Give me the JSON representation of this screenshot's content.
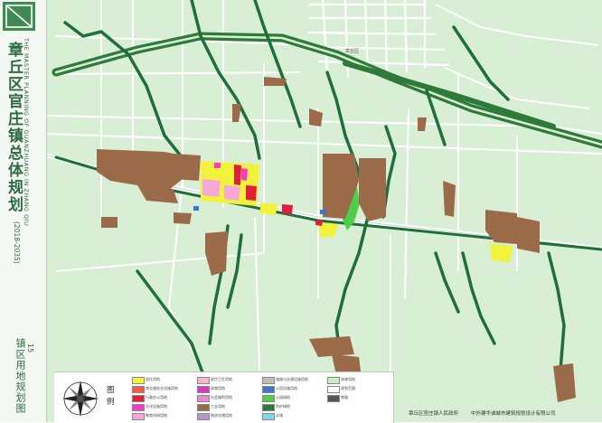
{
  "title": {
    "cn": "章丘区官庄镇总体规划",
    "en": "THE MASTER PLANNING OF GUANZHUANG IN ZHANG QIU",
    "period": "(2018-2035)"
  },
  "map_label": {
    "number": "15",
    "name": "镇区用地规划图"
  },
  "map_text": {
    "city_label": "章丘区"
  },
  "legend": {
    "title": "图例",
    "compass_icon": "north-arrow-icon",
    "items": [
      {
        "label": "居住用地",
        "color": "#f2f23a"
      },
      {
        "label": "商业服务业设施用地",
        "color": "#f25a4a"
      },
      {
        "label": "行政办公用地",
        "color": "#e01f3a"
      },
      {
        "label": "文化设施用地",
        "color": "#f53ad0"
      },
      {
        "label": "教育科研用地",
        "color": "#f7a8d9"
      },
      {
        "label": "医疗卫生用地",
        "color": "#f2b8d0"
      },
      {
        "label": "体育用地",
        "color": "#d93abb"
      },
      {
        "label": "社会福利用地",
        "color": "#e58bd0"
      },
      {
        "label": "工业用地",
        "color": "#9b6b49"
      },
      {
        "label": "物流仓储用地",
        "color": "#b896c6"
      },
      {
        "label": "道路与交通设施用地",
        "color": "#bdbdbd"
      },
      {
        "label": "公用设施用地",
        "color": "#3f77c8"
      },
      {
        "label": "公园绿地",
        "color": "#4fcf49"
      },
      {
        "label": "防护绿地",
        "color": "#2f7a3a"
      },
      {
        "label": "水域",
        "color": "#7fd4ef"
      },
      {
        "label": "农林用地",
        "color": "#ccebc8"
      },
      {
        "label": "规划范围",
        "color": "#ffffff"
      },
      {
        "label": "铁路",
        "color": "#555555"
      }
    ]
  },
  "footer": {
    "client": "章丘区官庄镇人民政府",
    "designer": "中外建华诚城市建筑规划设计有限公司"
  },
  "colors": {
    "base": "#d9efd5",
    "road": "#ffffff",
    "river": "#1f6f3c",
    "green_belt": "#2f7a3a",
    "industrial": "#9b6b49",
    "residential": "#f2f23a",
    "commercial": "#e01f3a",
    "education": "#f7a8d9",
    "park": "#4fcf49",
    "accent": "#3f8b53"
  }
}
